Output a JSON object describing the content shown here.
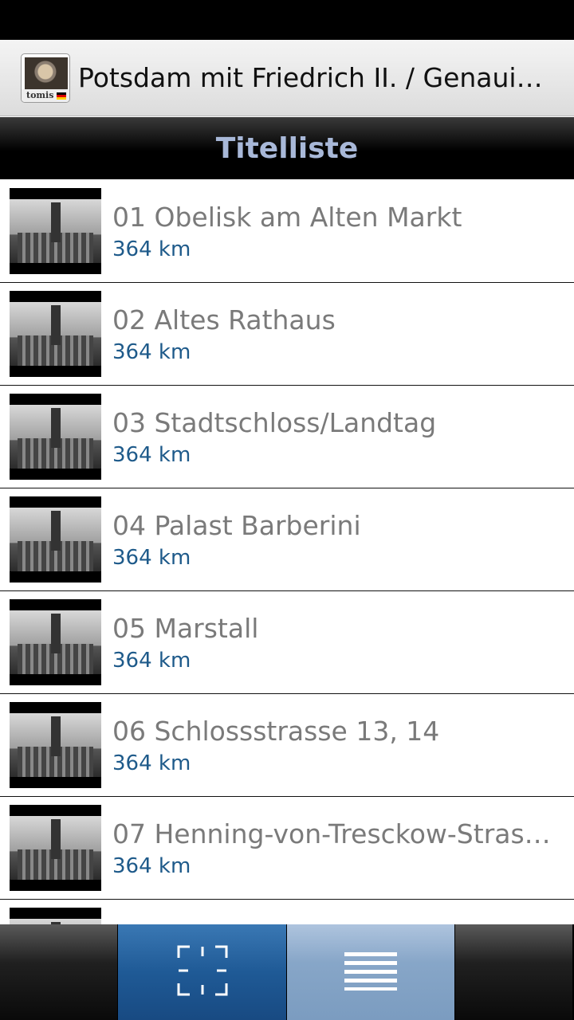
{
  "app_bar": {
    "title": "Potsdam mit Friedrich II. / Genauig…",
    "icon": "app-logo-icon",
    "icon_text": "tomis"
  },
  "header": {
    "title": "Titelliste"
  },
  "list": {
    "items": [
      {
        "title": "01 Obelisk am Alten Markt",
        "distance": "364 km"
      },
      {
        "title": "02 Altes Rathaus",
        "distance": "364 km"
      },
      {
        "title": "03 Stadtschloss/Landtag",
        "distance": "364 km"
      },
      {
        "title": "04 Palast Barberini",
        "distance": "364 km"
      },
      {
        "title": "05 Marstall",
        "distance": "364 km"
      },
      {
        "title": "06 Schlossstrasse 13, 14",
        "distance": "364 km"
      },
      {
        "title": "07 Henning-von-Tresckow-Stras…",
        "distance": "364 km"
      }
    ]
  },
  "bottom_nav": {
    "items": [
      {
        "icon": "scan-icon"
      },
      {
        "icon": "list-icon"
      }
    ]
  },
  "colors": {
    "header_text": "#a8b8d8",
    "distance_text": "#1e5a8a",
    "scan_button": "#1f5a96",
    "list_button": "#87a6c8"
  }
}
